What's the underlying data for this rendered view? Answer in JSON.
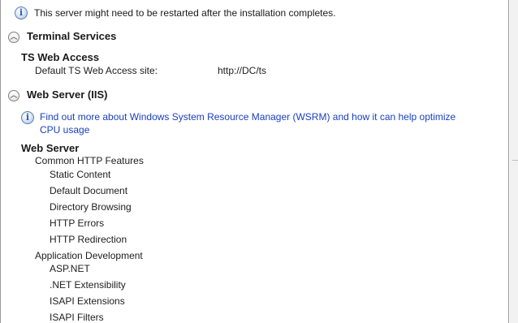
{
  "notice": {
    "icon": "info-icon",
    "text": "This server might need to be restarted after the installation completes."
  },
  "terminal_services": {
    "heading": "Terminal Services",
    "subheading": "TS Web Access",
    "setting_label": "Default TS Web Access site:",
    "setting_value": "http://DC/ts"
  },
  "web_server_iis": {
    "heading": "Web Server (IIS)",
    "wsrm_link_line1": "Find out more about Windows System Resource Manager (WSRM) and how it can help optimize",
    "wsrm_link_line2": "CPU usage",
    "subheading": "Web Server",
    "common_http": {
      "label": "Common HTTP Features",
      "items": [
        "Static Content",
        "Default Document",
        "Directory Browsing",
        "HTTP Errors",
        "HTTP Redirection"
      ]
    },
    "app_dev": {
      "label": "Application Development",
      "items": [
        "ASP.NET",
        ".NET Extensibility",
        "ISAPI Extensions",
        "ISAPI Filters"
      ]
    }
  },
  "colors": {
    "link": "#1a3fbf",
    "info_icon": "#2a5db0"
  }
}
